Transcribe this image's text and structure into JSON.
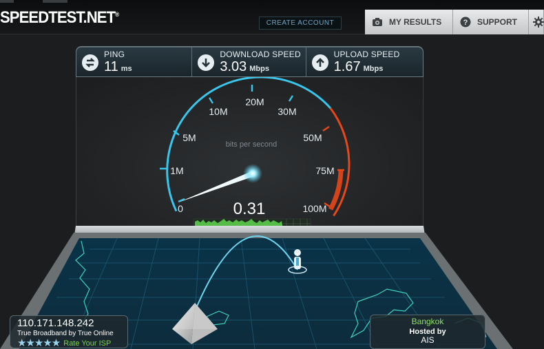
{
  "header": {
    "logo": "SPEEDTEST.NET",
    "logo_mark": "®",
    "create_account": "CREATE ACCOUNT",
    "tabs": [
      {
        "label": "MY RESULTS",
        "icon": "camera-icon"
      },
      {
        "label": "SUPPORT",
        "icon": "help-icon"
      },
      {
        "label": "",
        "icon": "gear-icon"
      }
    ]
  },
  "stats": {
    "ping": {
      "label": "PING",
      "value": "11",
      "unit": "ms",
      "icon": "ping-icon"
    },
    "download": {
      "label": "DOWNLOAD SPEED",
      "value": "3.03",
      "unit": "Mbps",
      "icon": "download-icon"
    },
    "upload": {
      "label": "UPLOAD SPEED",
      "value": "1.67",
      "unit": "Mbps",
      "icon": "upload-icon"
    }
  },
  "gauge": {
    "caption": "bits per second",
    "current_value": "0.31",
    "ticks": [
      "0",
      "1M",
      "5M",
      "10M",
      "20M",
      "30M",
      "50M",
      "75M",
      "100M"
    ],
    "accent": "#39c6ea",
    "danger": "#e8471a"
  },
  "client": {
    "ip": "110.171.148.242",
    "isp": "True Broadband by True Online",
    "rating_label": "Rate Your ISP",
    "stars": "★★★★★"
  },
  "server": {
    "city": "Bangkok",
    "hosted_by_label": "Hosted by",
    "host": "AIS"
  }
}
